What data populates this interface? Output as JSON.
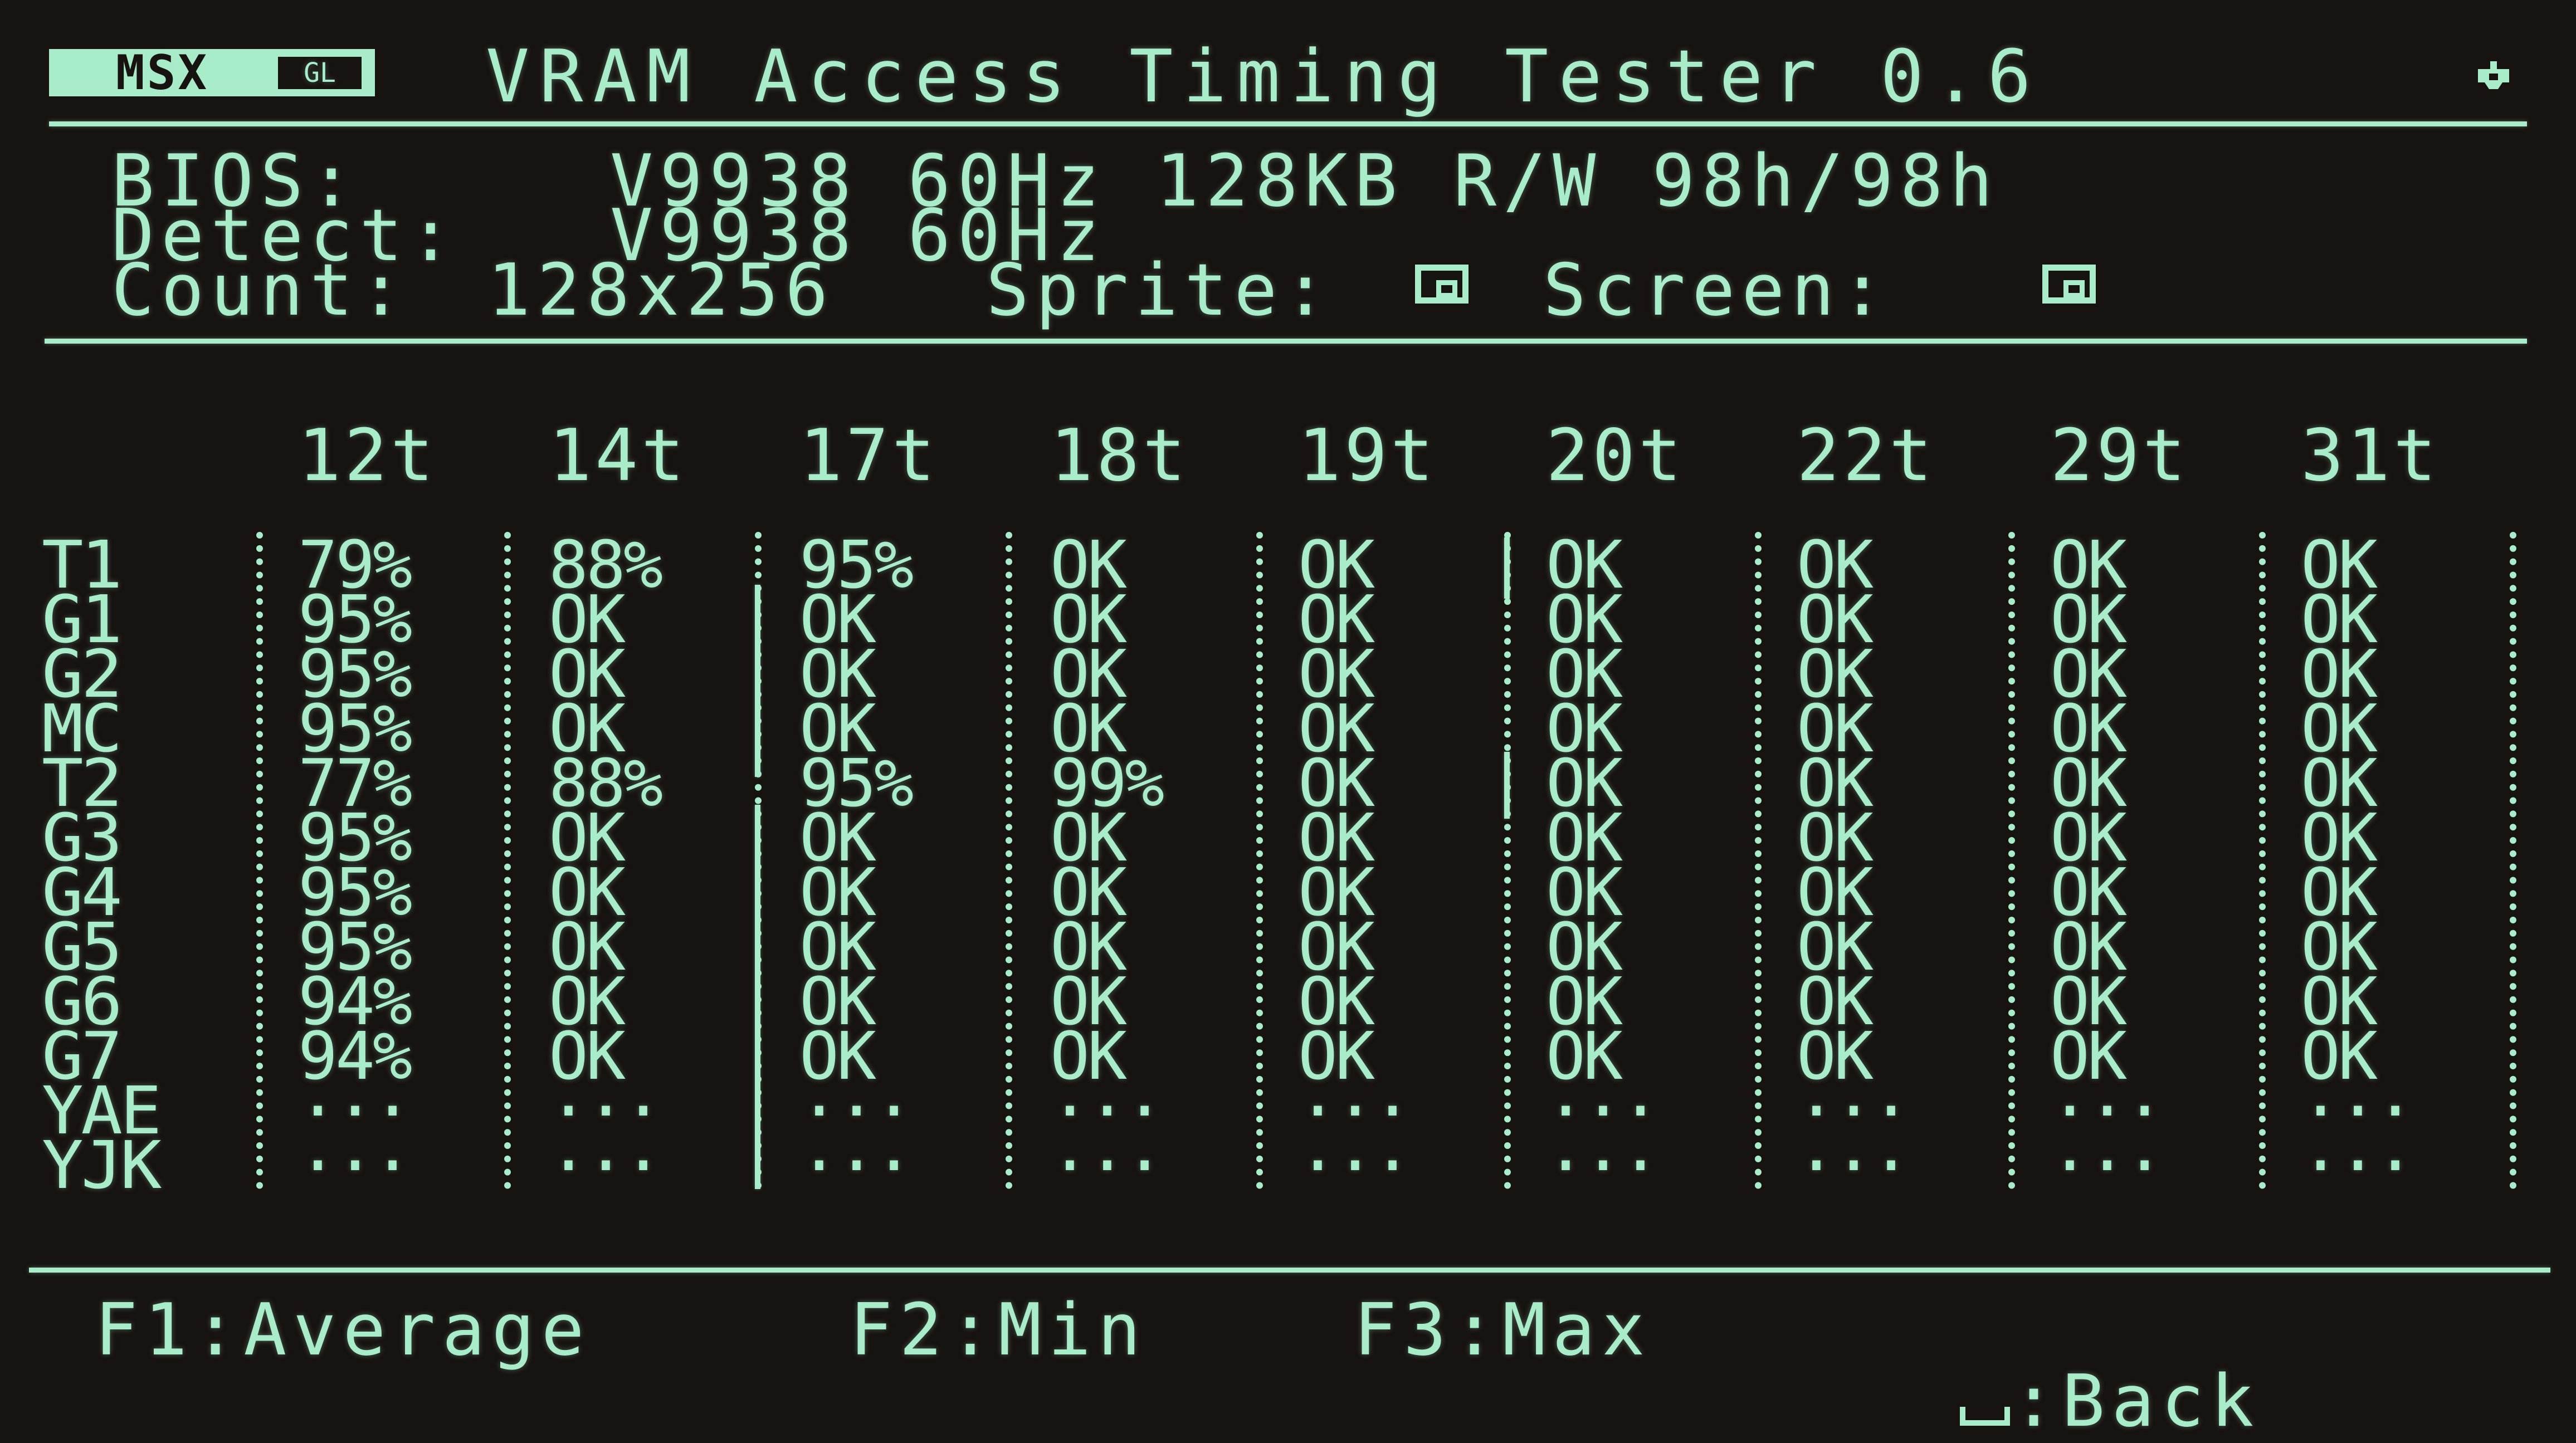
{
  "header": {
    "logo_text": "MSX",
    "logo_sub": "GL",
    "title": "VRAM Access Timing Tester 0.6",
    "corner_icon": "gamepad-icon"
  },
  "info": {
    "bios_label": "BIOS:",
    "bios_value": "V9938 60Hz 128KB R/W 98h/98h",
    "detect_label": "Detect:",
    "detect_value": "V9938 60Hz",
    "count_label": "Count:",
    "count_value": "128x256",
    "sprite_label": "Sprite:",
    "sprite_icon": "checkbox-icon",
    "screen_label": "Screen:",
    "screen_icon": "checkbox-icon"
  },
  "table": {
    "columns": [
      "12t",
      "14t",
      "17t",
      "18t",
      "19t",
      "20t",
      "22t",
      "29t",
      "31t"
    ],
    "rows": [
      {
        "label": "T1",
        "cells": [
          "79%",
          "88%",
          "95%",
          "OK",
          "OK",
          "OK",
          "OK",
          "OK",
          "OK"
        ]
      },
      {
        "label": "G1",
        "cells": [
          "95%",
          "OK",
          "OK",
          "OK",
          "OK",
          "OK",
          "OK",
          "OK",
          "OK"
        ]
      },
      {
        "label": "G2",
        "cells": [
          "95%",
          "OK",
          "OK",
          "OK",
          "OK",
          "OK",
          "OK",
          "OK",
          "OK"
        ]
      },
      {
        "label": "MC",
        "cells": [
          "95%",
          "OK",
          "OK",
          "OK",
          "OK",
          "OK",
          "OK",
          "OK",
          "OK"
        ]
      },
      {
        "label": "T2",
        "cells": [
          "77%",
          "88%",
          "95%",
          "99%",
          "OK",
          "OK",
          "OK",
          "OK",
          "OK"
        ]
      },
      {
        "label": "G3",
        "cells": [
          "95%",
          "OK",
          "OK",
          "OK",
          "OK",
          "OK",
          "OK",
          "OK",
          "OK"
        ]
      },
      {
        "label": "G4",
        "cells": [
          "95%",
          "OK",
          "OK",
          "OK",
          "OK",
          "OK",
          "OK",
          "OK",
          "OK"
        ]
      },
      {
        "label": "G5",
        "cells": [
          "95%",
          "OK",
          "OK",
          "OK",
          "OK",
          "OK",
          "OK",
          "OK",
          "OK"
        ]
      },
      {
        "label": "G6",
        "cells": [
          "94%",
          "OK",
          "OK",
          "OK",
          "OK",
          "OK",
          "OK",
          "OK",
          "OK"
        ]
      },
      {
        "label": "G7",
        "cells": [
          "94%",
          "OK",
          "OK",
          "OK",
          "OK",
          "OK",
          "OK",
          "OK",
          "OK"
        ]
      },
      {
        "label": "YAE",
        "cells": [
          "···",
          "···",
          "···",
          "···",
          "···",
          "···",
          "···",
          "···",
          "···"
        ]
      },
      {
        "label": "YJK",
        "cells": [
          "···",
          "···",
          "···",
          "···",
          "···",
          "···",
          "···",
          "···",
          "···"
        ]
      }
    ]
  },
  "footer": {
    "f1": "F1:Average",
    "f2": "F2:Min",
    "f3": "F3:Max",
    "back_icon": "space-key-icon",
    "back": ":Back"
  },
  "colors": {
    "foreground": "#a8ecc9",
    "background": "#171311"
  }
}
